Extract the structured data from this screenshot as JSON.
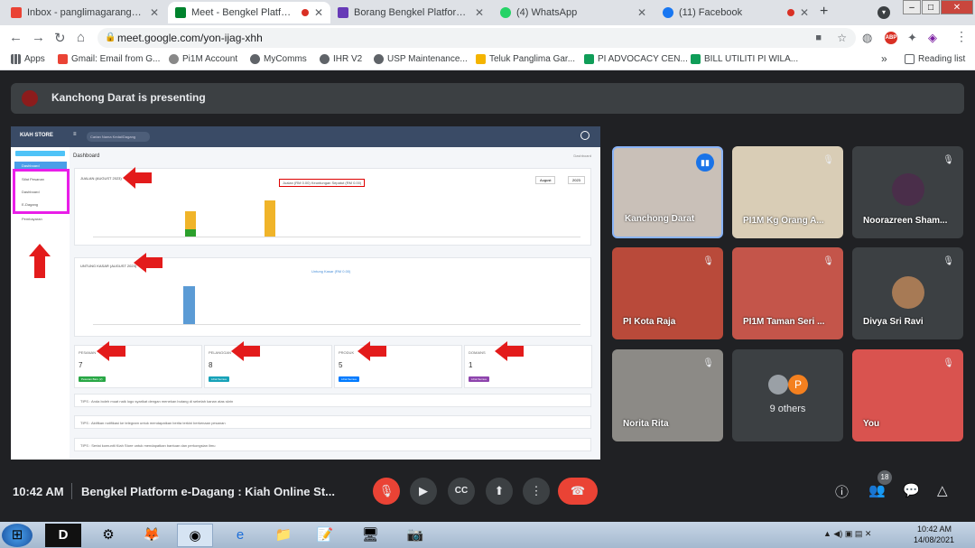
{
  "browser": {
    "tabs": [
      {
        "label": "Inbox - panglimagarang@pi1m",
        "icon": "gmail-icon",
        "color": "#ea4335"
      },
      {
        "label": "Meet - Bengkel Platform e",
        "icon": "meet-icon",
        "color": "#00832d",
        "active": true
      },
      {
        "label": "Borang Bengkel Platform e-Da",
        "icon": "forms-icon",
        "color": "#673ab7"
      },
      {
        "label": "(4) WhatsApp",
        "icon": "whatsapp-icon",
        "color": "#25d366"
      },
      {
        "label": "(11) Facebook",
        "icon": "facebook-icon",
        "color": "#1877f2"
      }
    ],
    "new_tab": "+",
    "url": "meet.google.com/yon-ijag-xhh",
    "bookmarks": [
      {
        "label": "Apps"
      },
      {
        "label": "Gmail: Email from G..."
      },
      {
        "label": "Pi1M Account"
      },
      {
        "label": "MyComms"
      },
      {
        "label": "IHR V2"
      },
      {
        "label": "USP Maintenance..."
      },
      {
        "label": "Teluk Panglima Gar..."
      },
      {
        "label": "PI ADVOCACY CEN..."
      },
      {
        "label": "BILL UTILITI PI WILA..."
      }
    ],
    "more_bookmarks": "»",
    "reading_list": "Reading list"
  },
  "meet": {
    "presenting": "Kanchong Darat is presenting",
    "time": "10:42 AM",
    "meeting_title": "Bengkel Platform e-Dagang : Kiah Online St...",
    "participant_count": "18",
    "participants": [
      {
        "name": "Kanchong Darat",
        "speaking": true,
        "bg": "#c9c0b8"
      },
      {
        "name": "PI1M Kg Orang A...",
        "bg": "#d9cdb6"
      },
      {
        "name": "Noorazreen Sham...",
        "bg": "#3c4043",
        "avatar": true
      },
      {
        "name": "PI Kota Raja",
        "bg": "#b94a3a"
      },
      {
        "name": "PI1M Taman Seri ...",
        "bg": "#c4554a"
      },
      {
        "name": "Divya Sri Ravi",
        "bg": "#3c4043",
        "avatar": true
      },
      {
        "name": "Norita Rita",
        "bg": "#8c8a86"
      },
      {
        "name": "9 others",
        "bg": "#3c4043",
        "others": true
      },
      {
        "name": "You",
        "bg": "#d9534f"
      }
    ],
    "others_initial": "P"
  },
  "shared_screen": {
    "store": "KIAH STORE",
    "search_placeholder": "Carian Nama Kedai/Dagang",
    "page": "Dashboard",
    "breadcrumb": "Dashboard",
    "sidebar": [
      "Dashboard",
      "Sifat Pesanan",
      "Dashboard",
      "E-Dagang",
      "Pembayaran"
    ],
    "sales_title": "JUALAN (AUGUST 2023)",
    "legend": [
      "Jualan (RM 0.00)",
      "Keuntungan Sepatut (RM 0.00)"
    ],
    "profit_title": "UNTUNG KASAR (AUGUST 2023)",
    "profit_legend": "Untung Kasar (RM 0.00)",
    "month": "August",
    "year": "2023",
    "stats": [
      {
        "label": "PESANAN",
        "value": "7",
        "btn": "Pesanan Baru (2)",
        "color": "#28a745"
      },
      {
        "label": "PELANGGAN",
        "value": "8",
        "btn": "Lihat Semua",
        "color": "#17a2b8"
      },
      {
        "label": "PRODUK",
        "value": "5",
        "btn": "Lihat Semua",
        "color": "#007bff"
      },
      {
        "label": "DOMAINS",
        "value": "1",
        "btn": "Lihat Semua",
        "color": "#8e44ad"
      }
    ],
    "tips": [
      "TIPS : Anda boleh muat naik logo syarikat dengan menekan butang di sebelah kanan atas skrin",
      "TIPS : Aktifkan notifikasi ke telegram untuk mendapatkan berita terkini berkenaan pesanan",
      "TIPS : Sertai komuniti Kiah Store untuk mendapatkan bantuan dan perkongsian ilmu"
    ]
  },
  "system": {
    "clock_time": "10:42 AM",
    "clock_date": "14/08/2021"
  }
}
